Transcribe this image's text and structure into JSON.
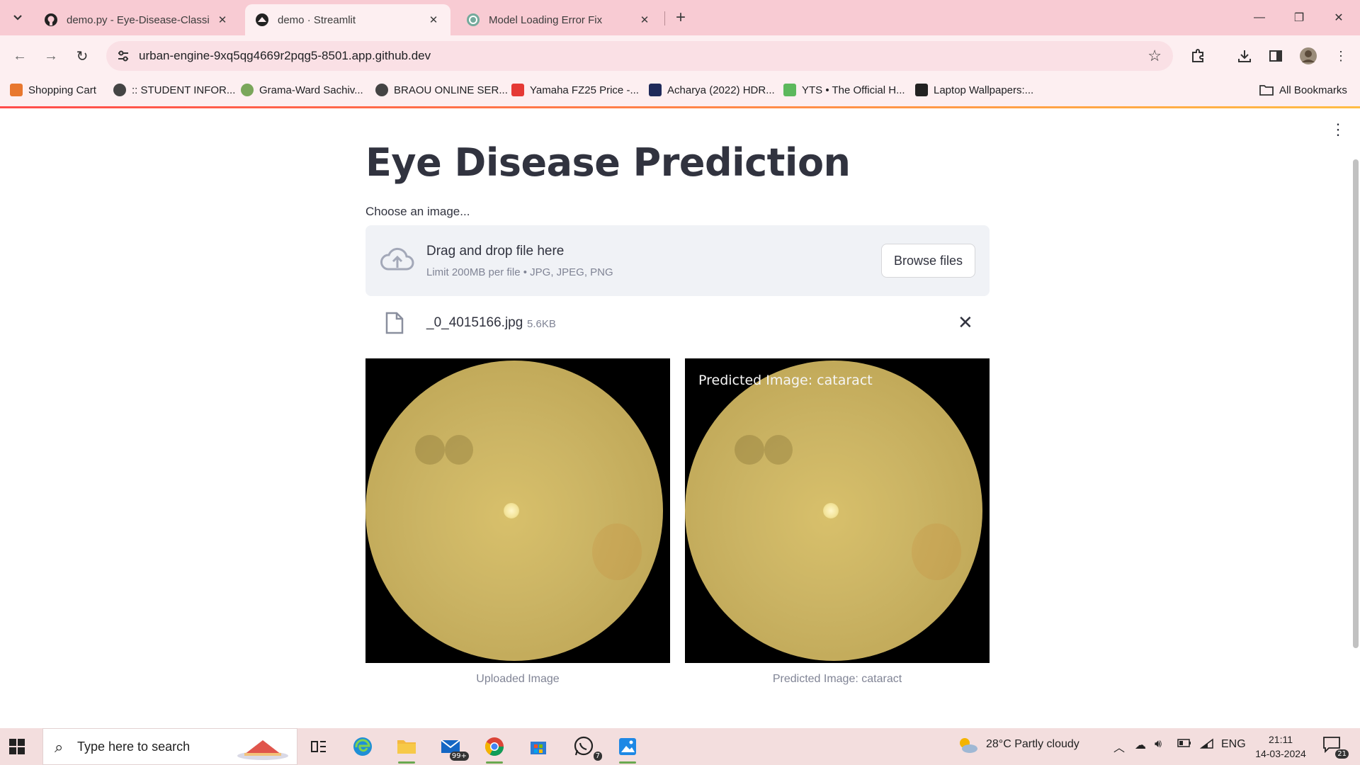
{
  "browser": {
    "tabs": [
      {
        "title": "demo.py - Eye-Disease-Classific",
        "icon": "github-icon",
        "active": false
      },
      {
        "title": "demo · Streamlit",
        "icon": "streamlit-icon",
        "active": true
      },
      {
        "title": "Model Loading Error Fix",
        "icon": "chatgpt-icon",
        "active": false
      }
    ],
    "new_tab": "+",
    "url": "urban-engine-9xq5qg4669r2pqg5-8501.app.github.dev",
    "bookmarks": [
      {
        "label": "Shopping Cart",
        "color": "#e8772e"
      },
      {
        "label": ":: STUDENT INFOR...",
        "color": "#444444"
      },
      {
        "label": "Grama-Ward Sachiv...",
        "color": "#7aa65a"
      },
      {
        "label": "BRAOU ONLINE SER...",
        "color": "#444444"
      },
      {
        "label": "Yamaha FZ25 Price -...",
        "color": "#e53935"
      },
      {
        "label": "Acharya (2022) HDR...",
        "color": "#1f2a5a"
      },
      {
        "label": "YTS • The Official H...",
        "color": "#5cb85c"
      },
      {
        "label": "Laptop Wallpapers:...",
        "color": "#222222"
      }
    ],
    "all_bookmarks": "All Bookmarks"
  },
  "page": {
    "title": "Eye Disease Prediction",
    "uploader_label": "Choose an image...",
    "dropzone_title": "Drag and drop file here",
    "dropzone_limit": "Limit 200MB per file • JPG, JPEG, PNG",
    "browse_button": "Browse files",
    "file_name": "_0_4015166.jpg",
    "file_size": "5.6KB",
    "overlay_text": "Predicted Image: cataract",
    "caption_uploaded": "Uploaded Image",
    "caption_predicted": "Predicted Image: cataract"
  },
  "taskbar": {
    "search_placeholder": "Type here to search",
    "mail_badge": "99+",
    "whatsapp_badge": "7",
    "weather": "28°C  Partly cloudy",
    "language": "ENG",
    "time": "21:11",
    "date": "14-03-2024",
    "notifications": "21"
  }
}
